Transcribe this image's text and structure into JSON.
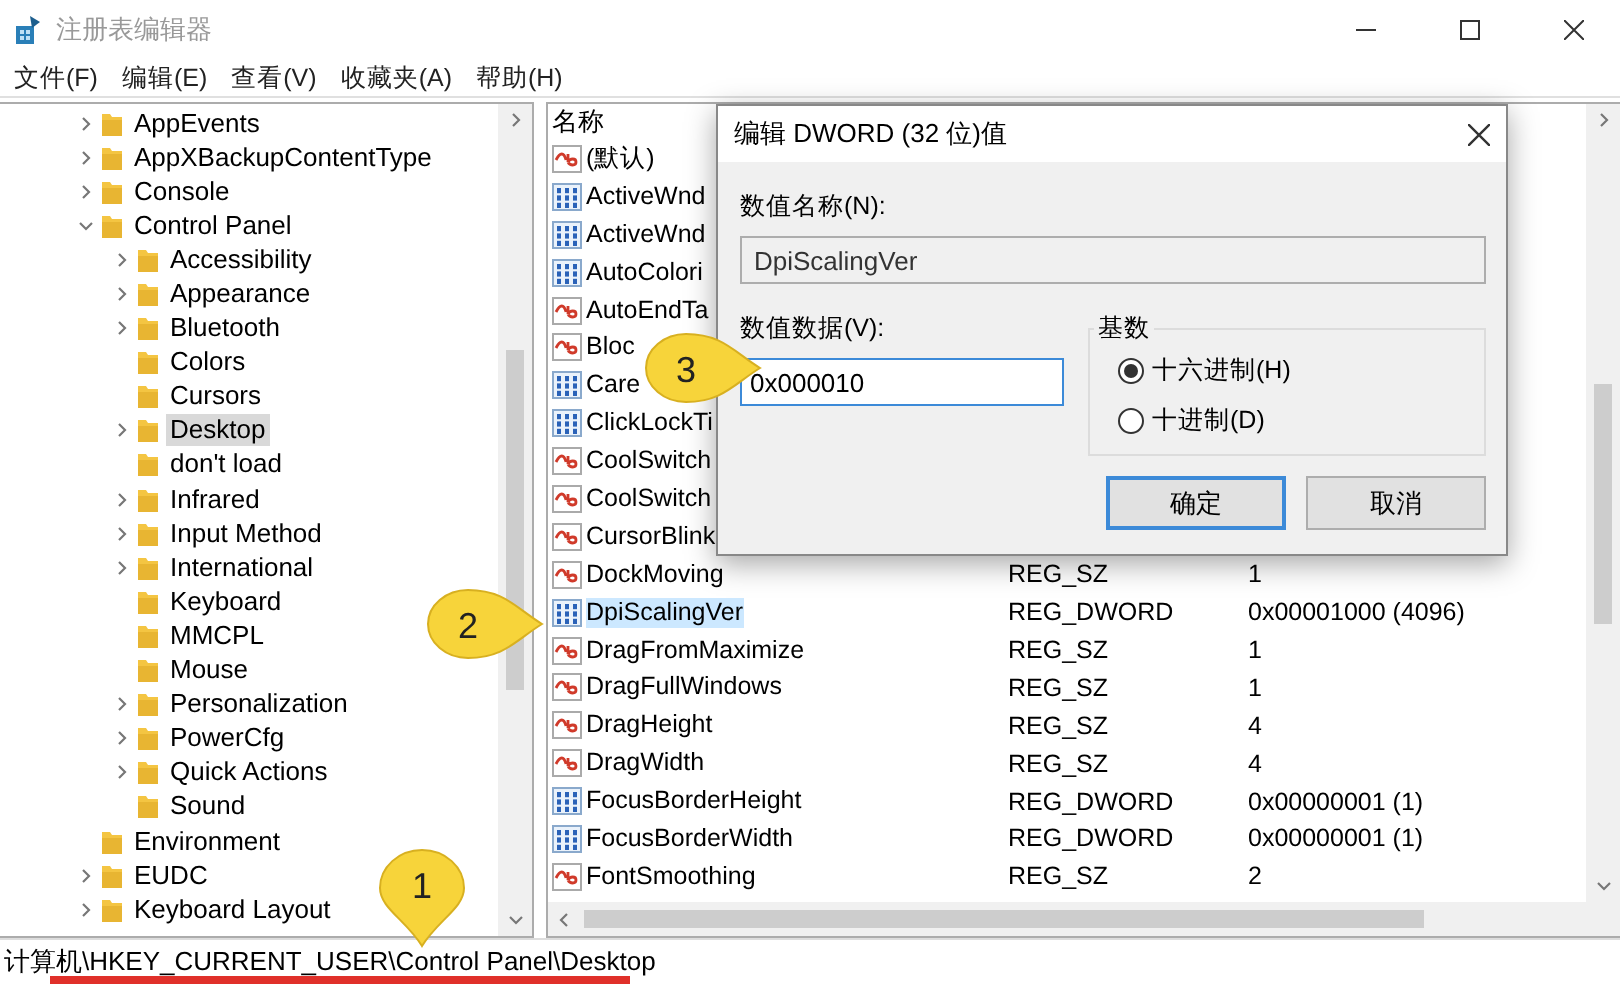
{
  "window": {
    "title": "注册表编辑器"
  },
  "menu": [
    "文件(F)",
    "编辑(E)",
    "查看(V)",
    "收藏夹(A)",
    "帮助(H)"
  ],
  "tree": [
    {
      "label": "AppEvents",
      "expanded": false,
      "selected": false
    },
    {
      "label": "AppXBackupContentType",
      "expanded": false,
      "selected": false
    },
    {
      "label": "Console",
      "expanded": false,
      "selected": false
    },
    {
      "label": "Control Panel",
      "expanded": true,
      "selected": false,
      "children": [
        {
          "label": "Accessibility",
          "expanded": false,
          "selected": false
        },
        {
          "label": "Appearance",
          "expanded": false,
          "selected": false
        },
        {
          "label": "Bluetooth",
          "expanded": false,
          "selected": false
        },
        {
          "label": "Colors",
          "selected": false
        },
        {
          "label": "Cursors",
          "selected": false
        },
        {
          "label": "Desktop",
          "expanded": false,
          "selected": true
        },
        {
          "label": "don't load",
          "selected": false
        },
        {
          "label": "Infrared",
          "expanded": false,
          "selected": false
        },
        {
          "label": "Input Method",
          "expanded": false,
          "selected": false
        },
        {
          "label": "International",
          "expanded": false,
          "selected": false
        },
        {
          "label": "Keyboard",
          "selected": false
        },
        {
          "label": "MMCPL",
          "selected": false
        },
        {
          "label": "Mouse",
          "selected": false
        },
        {
          "label": "Personalization",
          "expanded": false,
          "selected": false
        },
        {
          "label": "PowerCfg",
          "expanded": false,
          "selected": false
        },
        {
          "label": "Quick Actions",
          "expanded": false,
          "selected": false
        },
        {
          "label": "Sound",
          "selected": false
        }
      ]
    },
    {
      "label": "Environment",
      "selected": false
    },
    {
      "label": "EUDC",
      "expanded": false,
      "selected": false
    },
    {
      "label": "Keyboard Layout",
      "expanded": false,
      "selected": false
    }
  ],
  "list": {
    "column_name": "名称",
    "rows": [
      {
        "kind": "string",
        "name": "(默认)",
        "selected": false
      },
      {
        "kind": "dword",
        "name": "ActiveWnd",
        "selected": false
      },
      {
        "kind": "dword",
        "name": "ActiveWnd",
        "selected": false
      },
      {
        "kind": "dword",
        "name": "AutoColori",
        "selected": false
      },
      {
        "kind": "string",
        "name": "AutoEndTa",
        "selected": false
      },
      {
        "kind": "string",
        "name": "Bloc",
        "selected": false
      },
      {
        "kind": "dword",
        "name": "Care",
        "selected": false
      },
      {
        "kind": "dword",
        "name": "ClickLockTi",
        "selected": false
      },
      {
        "kind": "string",
        "name": "CoolSwitch",
        "selected": false
      },
      {
        "kind": "string",
        "name": "CoolSwitch",
        "selected": false
      },
      {
        "kind": "string",
        "name": "CursorBlink",
        "selected": false
      },
      {
        "kind": "string",
        "name": "DockMoving",
        "type": "REG_SZ",
        "data": "1",
        "selected": false
      },
      {
        "kind": "dword",
        "name": "DpiScalingVer",
        "type": "REG_DWORD",
        "data": "0x00001000 (4096)",
        "selected": true
      },
      {
        "kind": "string",
        "name": "DragFromMaximize",
        "type": "REG_SZ",
        "data": "1",
        "selected": false
      },
      {
        "kind": "string",
        "name": "DragFullWindows",
        "type": "REG_SZ",
        "data": "1",
        "selected": false
      },
      {
        "kind": "string",
        "name": "DragHeight",
        "type": "REG_SZ",
        "data": "4",
        "selected": false
      },
      {
        "kind": "string",
        "name": "DragWidth",
        "type": "REG_SZ",
        "data": "4",
        "selected": false
      },
      {
        "kind": "dword",
        "name": "FocusBorderHeight",
        "type": "REG_DWORD",
        "data": "0x00000001 (1)",
        "selected": false
      },
      {
        "kind": "dword",
        "name": "FocusBorderWidth",
        "type": "REG_DWORD",
        "data": "0x00000001 (1)",
        "selected": false
      },
      {
        "kind": "string",
        "name": "FontSmoothing",
        "type": "REG_SZ",
        "data": "2",
        "selected": false
      }
    ]
  },
  "status_bar": "计算机\\HKEY_CURRENT_USER\\Control Panel\\Desktop",
  "dialog": {
    "title": "编辑 DWORD (32 位)值",
    "name_label": "数值名称(N):",
    "name_value": "DpiScalingVer",
    "data_label": "数值数据(V):",
    "data_value": "0x000010",
    "base_label": "基数",
    "bases": [
      {
        "label": "十六进制(H)",
        "selected": true
      },
      {
        "label": "十进制(D)",
        "selected": false
      }
    ],
    "buttons": [
      {
        "label": "确定",
        "kind": "default"
      },
      {
        "label": "取消",
        "kind": "normal"
      }
    ]
  },
  "callouts": [
    {
      "text": "1",
      "kind": "down"
    },
    {
      "text": "2",
      "kind": "right"
    },
    {
      "text": "3",
      "kind": "right"
    }
  ]
}
